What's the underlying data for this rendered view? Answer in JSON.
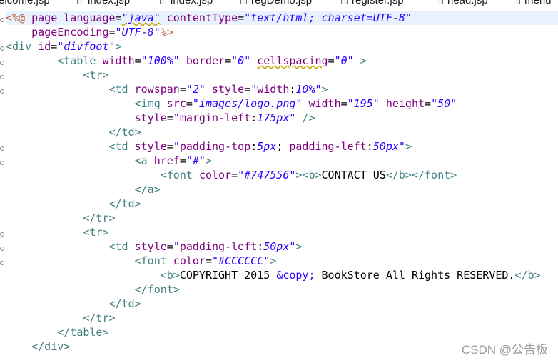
{
  "tabs": [
    {
      "label": "elcome.jsp"
    },
    {
      "label": "index.jsp"
    },
    {
      "label": "index.jsp"
    },
    {
      "label": "regDemo.jsp"
    },
    {
      "label": "register.jsp"
    },
    {
      "label": "head.jsp"
    },
    {
      "label": "menu"
    }
  ],
  "code": {
    "l1": {
      "open": "<%@",
      "page": " page ",
      "a1": "language",
      "eq1": "=",
      "v1": "\"java\"",
      "a2": "contentType",
      "eq2": "=",
      "v2": "\"text/html; charset=UTF-8\""
    },
    "l2": {
      "a": "pageEncoding",
      "eq": "=",
      "v": "\"UTF-8\"",
      "close": "%>"
    },
    "l3": {
      "tag": "<div",
      "a": "id",
      "eq": "=",
      "v": "\"divfoot\"",
      "end": ">"
    },
    "l4": {
      "tag": "<table",
      "a1": "width",
      "eq1": "=",
      "v1": "\"100%\"",
      "a2": "border",
      "eq2": "=",
      "v2": "\"0\"",
      "a3": "cellspacing",
      "eq3": "=",
      "v3": "\"0\"",
      "end": " >"
    },
    "l5": {
      "tag": "<tr>"
    },
    "l6": {
      "tag": "<td",
      "a1": "rowspan",
      "eq1": "=",
      "v1": "\"2\"",
      "a2": "style",
      "eq2": "=",
      "q1": "\"",
      "p1": "width",
      "c1": ":",
      "pv1": "10%",
      "q2": "\"",
      "end": ">"
    },
    "l7": {
      "tag": "<img",
      "a1": "src",
      "eq1": "=",
      "v1": "\"images/logo.png\"",
      "a2": "width",
      "eq2": "=",
      "v2": "\"195\"",
      "a3": "height",
      "eq3": "=",
      "v3": "\"50\""
    },
    "l8": {
      "a": "style",
      "eq": "=",
      "q1": "\"",
      "p": "margin-left",
      "c": ":",
      "pv": "175px",
      "q2": "\"",
      "end": " />"
    },
    "l9": {
      "tag": "</td>"
    },
    "l10": {
      "tag": "<td",
      "a": "style",
      "eq": "=",
      "q1": "\"",
      "p1": "padding-top",
      "c1": ":",
      "pv1": "5px",
      "sep": "; ",
      "p2": "padding-left",
      "c2": ":",
      "pv2": "50px",
      "q2": "\"",
      "end": ">"
    },
    "l11": {
      "tag": "<a",
      "a": "href",
      "eq": "=",
      "v": "\"#\"",
      "end": ">"
    },
    "l12": {
      "tag": "<font",
      "a": "color",
      "eq": "=",
      "v": "\"#747556\"",
      "end": "><b>",
      "text": "CONTACT US",
      "close": "</b></font>"
    },
    "l13": {
      "tag": "</a>"
    },
    "l14": {
      "tag": "</td>"
    },
    "l15": {
      "tag": "</tr>"
    },
    "l16": {
      "tag": "<tr>"
    },
    "l17": {
      "tag": "<td",
      "a": "style",
      "eq": "=",
      "q1": "\"",
      "p": "padding-left",
      "c": ":",
      "pv": "50px",
      "q2": "\"",
      "end": ">"
    },
    "l18": {
      "tag": "<font",
      "a": "color",
      "eq": "=",
      "v": "\"#CCCCCC\"",
      "end": ">"
    },
    "l19": {
      "open": "<b>",
      "t1": "COPYRIGHT 2015 ",
      "ent": "&copy;",
      "t2": " BookStore All Rights RESERVED.",
      "close": "</b>"
    },
    "l20": {
      "tag": "</font>"
    },
    "l21": {
      "tag": "</td>"
    },
    "l22": {
      "tag": "</tr>"
    },
    "l23": {
      "tag": "</table>"
    },
    "l24": {
      "tag": "</div>"
    }
  },
  "watermark": "CSDN @公告板",
  "colors": {
    "tag": "#3f7f7f",
    "attribute": "#7f007f",
    "value": "#2a00ff",
    "jsp_delimiter": "#bf5f3f",
    "current_line": "#e8f2fe"
  }
}
